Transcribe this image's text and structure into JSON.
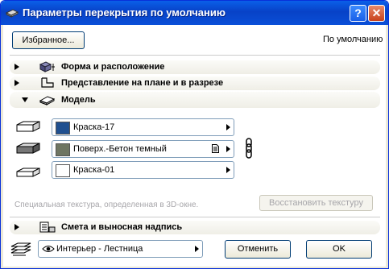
{
  "window": {
    "title": "Параметры перекрытия по умолчанию",
    "help_glyph": "?",
    "close_glyph": "✕"
  },
  "top": {
    "favorites_label": "Избранное...",
    "default_label": "По умолчанию"
  },
  "sections": {
    "shape": "Форма и расположение",
    "plan": "Представление на плане и в разрезе",
    "model": "Модель",
    "listing": "Смета и выносная надпись"
  },
  "materials": [
    {
      "name": "Краска-17",
      "color": "#1f4f8f"
    },
    {
      "name": "Поверх.-Бетон темный",
      "color": "#6e7562"
    },
    {
      "name": "Краска-01",
      "color": "#ffffff"
    }
  ],
  "texture": {
    "note": "Специальная текстура, определенная в 3D-окне.",
    "restore_label": "Восстановить текстуру"
  },
  "bottom": {
    "layer_value": "Интерьер - Лестница",
    "cancel_label": "Отменить",
    "ok_label": "OK"
  }
}
